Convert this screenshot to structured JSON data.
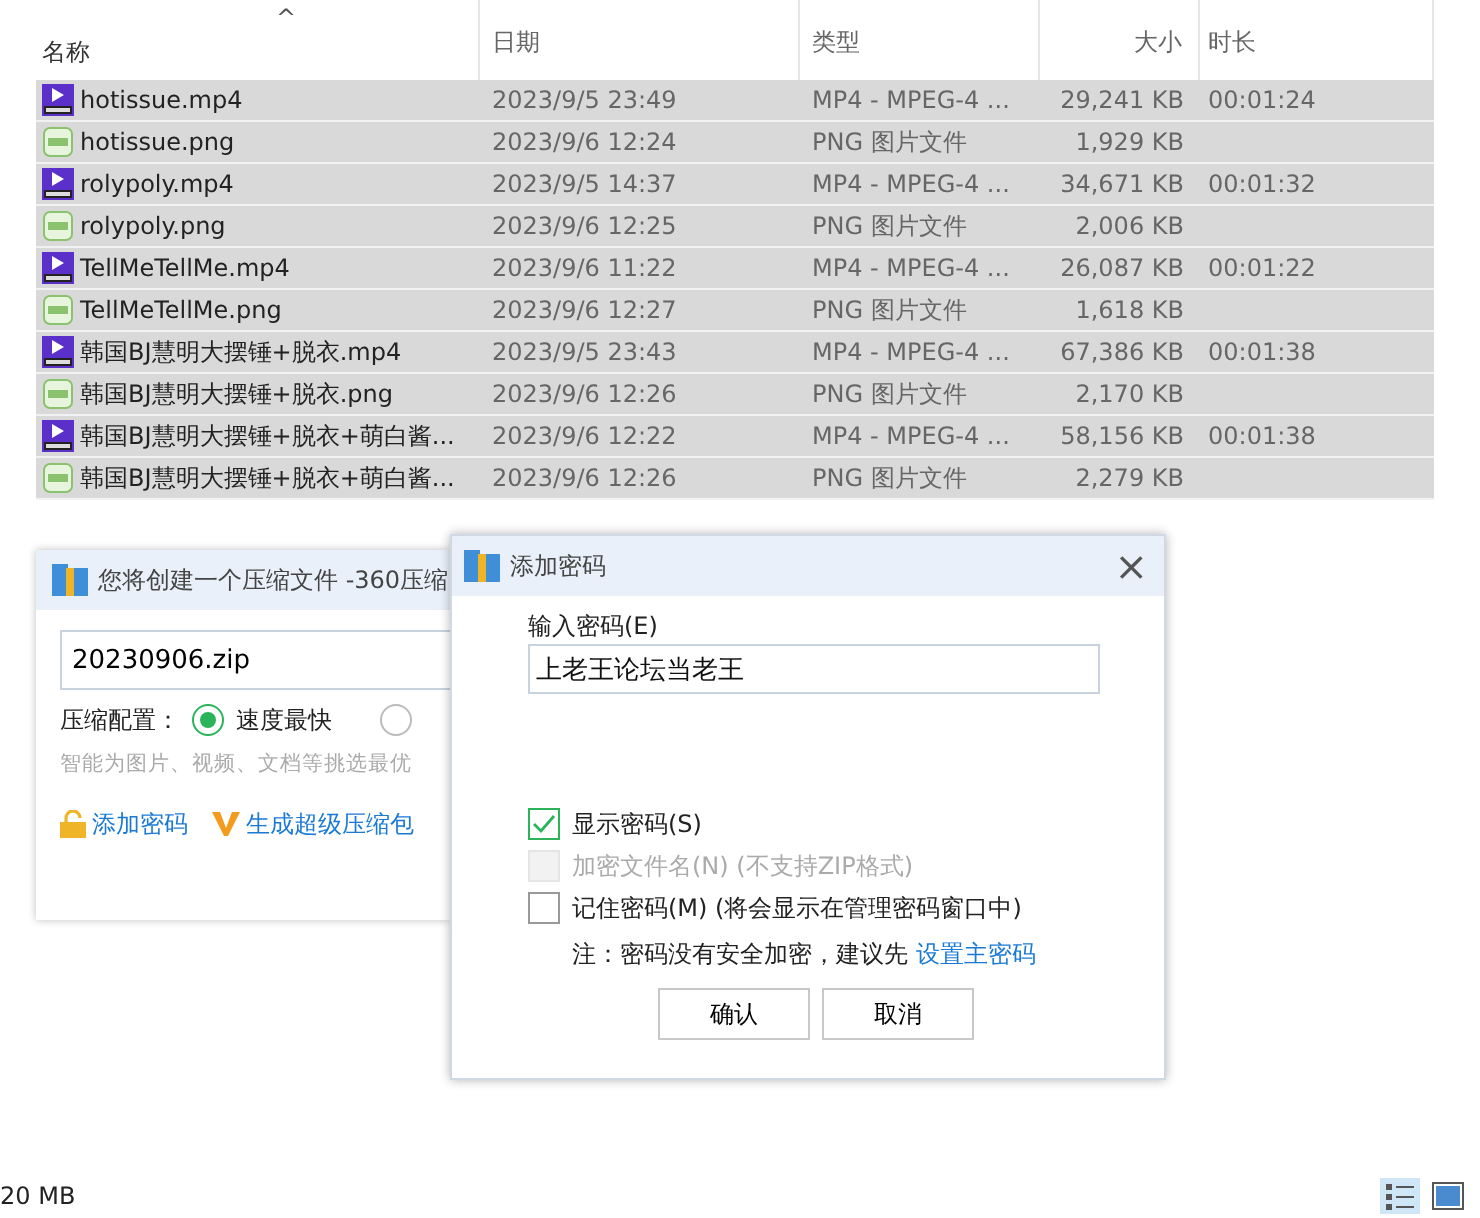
{
  "file_list": {
    "sort_arrow": "^",
    "columns": [
      "名称",
      "日期",
      "类型",
      "大小",
      "时长"
    ],
    "rows": [
      {
        "kind": "video",
        "name": "hotissue.mp4",
        "date": "2023/9/5 23:49",
        "type": "MP4 - MPEG-4 ...",
        "size": "29,241 KB",
        "duration": "00:01:24",
        "selected": true
      },
      {
        "kind": "image",
        "name": "hotissue.png",
        "date": "2023/9/6 12:24",
        "type": "PNG 图片文件",
        "size": "1,929 KB",
        "selected": true
      },
      {
        "kind": "video",
        "name": "rolypoly.mp4",
        "date": "2023/9/5 14:37",
        "type": "MP4 - MPEG-4 ...",
        "size": "34,671 KB",
        "duration": "00:01:32",
        "selected": true
      },
      {
        "kind": "image",
        "name": "rolypoly.png",
        "date": "2023/9/6 12:25",
        "type": "PNG 图片文件",
        "size": "2,006 KB",
        "selected": true
      },
      {
        "kind": "video",
        "name": "TellMeTellMe.mp4",
        "date": "2023/9/6 11:22",
        "type": "MP4 - MPEG-4 ...",
        "size": "26,087 KB",
        "duration": "00:01:22",
        "selected": true
      },
      {
        "kind": "image",
        "name": "TellMeTellMe.png",
        "date": "2023/9/6 12:27",
        "type": "PNG 图片文件",
        "size": "1,618 KB",
        "selected": true
      },
      {
        "kind": "video",
        "name": "韩国BJ慧明大摆锤+脱衣.mp4",
        "date": "2023/9/5 23:43",
        "type": "MP4 - MPEG-4 ...",
        "size": "67,386 KB",
        "duration": "00:01:38",
        "selected": true
      },
      {
        "kind": "image",
        "name": "韩国BJ慧明大摆锤+脱衣.png",
        "date": "2023/9/6 12:26",
        "type": "PNG 图片文件",
        "size": "2,170 KB",
        "selected": true
      },
      {
        "kind": "video",
        "name": "韩国BJ慧明大摆锤+脱衣+萌白酱...",
        "date": "2023/9/6 12:22",
        "type": "MP4 - MPEG-4 ...",
        "size": "58,156 KB",
        "duration": "00:01:38",
        "selected": true
      },
      {
        "kind": "image",
        "name": "韩国BJ慧明大摆锤+脱衣+萌白酱...",
        "date": "2023/9/6 12:26",
        "type": "PNG 图片文件",
        "size": "2,279 KB",
        "selected": true
      }
    ]
  },
  "compress_dialog": {
    "title": "您将创建一个压缩文件 -360压缩",
    "filename": "20230906.zip",
    "config_label": "压缩配置：",
    "options": [
      {
        "label": "速度最快",
        "selected": true
      },
      {
        "selected": false
      }
    ],
    "hint": "智能为图片、视频、文档等挑选最优",
    "links": [
      "添加密码",
      "生成超级压缩包"
    ]
  },
  "password_dialog": {
    "title": "添加密码",
    "close": "×",
    "field_label": "输入密码(E)",
    "password": "上老王论坛当老王",
    "checkboxes": [
      {
        "label": "显示密码(S)",
        "checked": true,
        "disabled": false
      },
      {
        "label": "加密文件名(N) (不支持ZIP格式)",
        "checked": false,
        "disabled": true
      },
      {
        "label": "记住密码(M) (将会显示在管理密码窗口中)",
        "checked": false,
        "disabled": false
      }
    ],
    "note": "注：密码没有安全加密，建议先",
    "note_link": "设置主密码",
    "buttons": [
      "确认",
      "取消"
    ]
  },
  "status_bar": {
    "size": "20 MB"
  }
}
